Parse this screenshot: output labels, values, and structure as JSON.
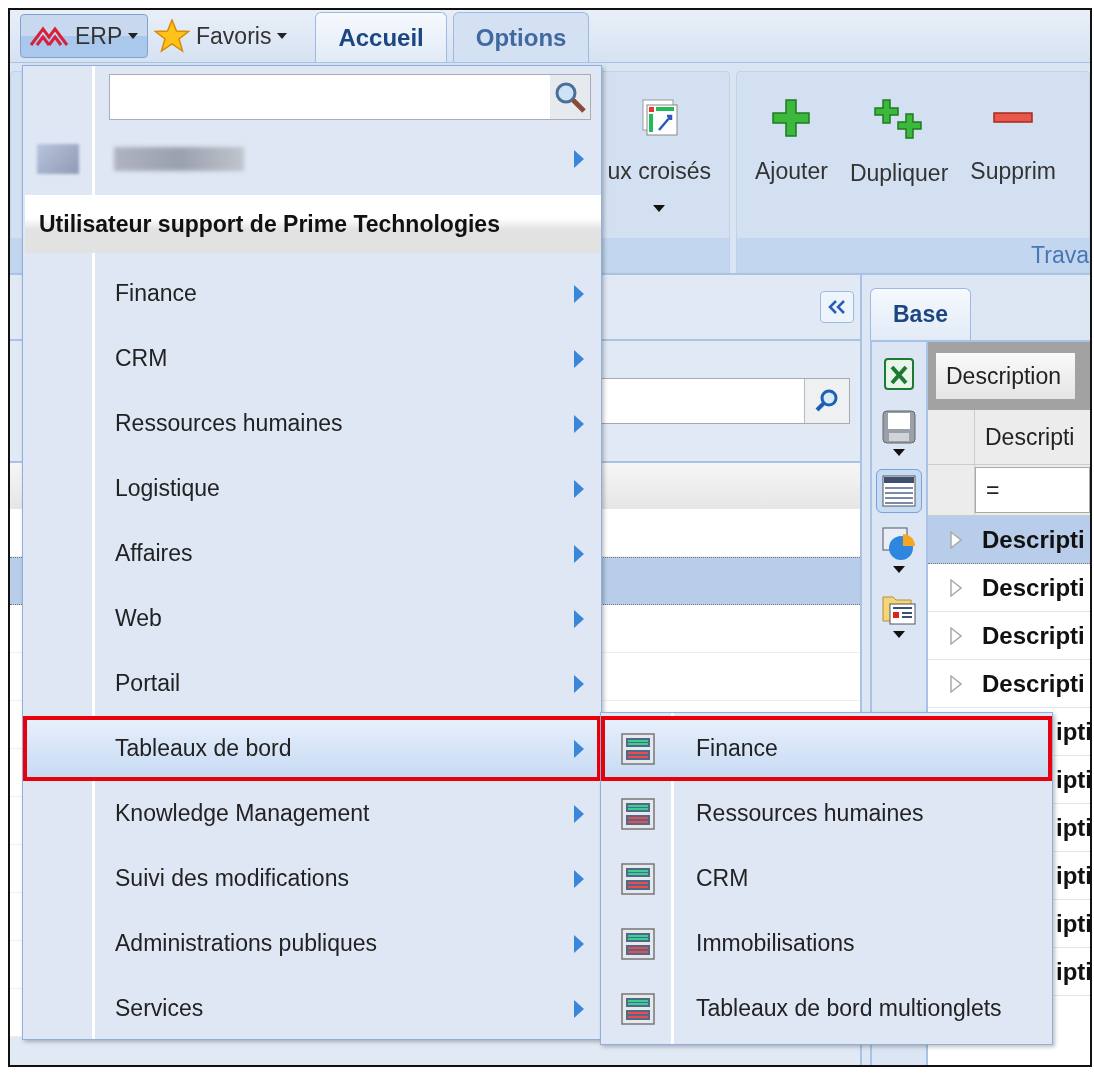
{
  "toolbar": {
    "app_button": {
      "label": "ERP"
    },
    "favorites_button": {
      "label": "Favoris"
    }
  },
  "tabs": [
    {
      "label": "Accueil",
      "selected": true
    },
    {
      "label": "Options",
      "selected": false
    }
  ],
  "ribbon": {
    "groups": [
      {
        "buttons": [
          {
            "label": "ux croisés",
            "kind": "pivot",
            "dropdown": true
          }
        ]
      },
      {
        "label": "Trava",
        "buttons": [
          {
            "label": "Ajouter",
            "kind": "add",
            "dropdown": false
          },
          {
            "label": "Dupliquer",
            "kind": "duplicate",
            "dropdown": false
          },
          {
            "label": "Supprim",
            "kind": "delete",
            "dropdown": false
          }
        ]
      }
    ]
  },
  "left_panel": {
    "rows": [
      {
        "selected": false
      },
      {
        "selected": true
      },
      {
        "selected": false
      },
      {
        "selected": false
      },
      {
        "selected": false
      },
      {
        "selected": false
      },
      {
        "selected": false
      },
      {
        "selected": false
      },
      {
        "selected": false
      },
      {
        "selected": false
      },
      {
        "selected": false
      }
    ]
  },
  "right_panel": {
    "tabs": [
      {
        "label": "Base",
        "selected": true
      }
    ],
    "tools": [
      {
        "kind": "excel",
        "selected": false,
        "dropdown": false
      },
      {
        "kind": "save",
        "selected": false,
        "dropdown": true
      },
      {
        "kind": "grid",
        "selected": true,
        "dropdown": false
      },
      {
        "kind": "chart",
        "selected": false,
        "dropdown": true
      },
      {
        "kind": "report",
        "selected": false,
        "dropdown": true
      }
    ],
    "group_by": {
      "label": "Description"
    },
    "columns": [
      {
        "label": "Descripti"
      }
    ],
    "filter": "=",
    "rows": [
      {
        "text": "Descripti",
        "kind": "full",
        "selected": true
      },
      {
        "text": "Descripti",
        "kind": "full",
        "selected": false
      },
      {
        "text": "Descripti",
        "kind": "full",
        "selected": false
      },
      {
        "text": "Descripti",
        "kind": "full",
        "selected": false
      },
      {
        "text": "ipti",
        "kind": "covered",
        "selected": false
      },
      {
        "text": "ipti",
        "kind": "covered",
        "selected": false
      },
      {
        "text": "ipti",
        "kind": "covered",
        "selected": false
      },
      {
        "text": "ipti",
        "kind": "covered",
        "selected": false
      },
      {
        "text": "ipti",
        "kind": "covered",
        "selected": false
      },
      {
        "text": "ipti",
        "kind": "covered",
        "selected": false
      }
    ]
  },
  "menu": {
    "user_header": "Utilisateur support de Prime Technologies",
    "items": [
      {
        "label": "Finance",
        "selected": false
      },
      {
        "label": "CRM",
        "selected": false
      },
      {
        "label": "Ressources humaines",
        "selected": false
      },
      {
        "label": "Logistique",
        "selected": false
      },
      {
        "label": "Affaires",
        "selected": false
      },
      {
        "label": "Web",
        "selected": false
      },
      {
        "label": "Portail",
        "selected": false
      },
      {
        "label": "Tableaux de bord",
        "selected": true
      },
      {
        "label": "Knowledge Management",
        "selected": false
      },
      {
        "label": "Suivi des modifications",
        "selected": false
      },
      {
        "label": "Administrations publiques",
        "selected": false
      },
      {
        "label": "Services",
        "selected": false
      }
    ],
    "submenu": {
      "items": [
        {
          "label": "Finance",
          "selected": true
        },
        {
          "label": "Ressources humaines",
          "selected": false
        },
        {
          "label": "CRM",
          "selected": false
        },
        {
          "label": "Immobilisations",
          "selected": false
        },
        {
          "label": "Tableaux de bord multionglets",
          "selected": false
        }
      ]
    }
  }
}
